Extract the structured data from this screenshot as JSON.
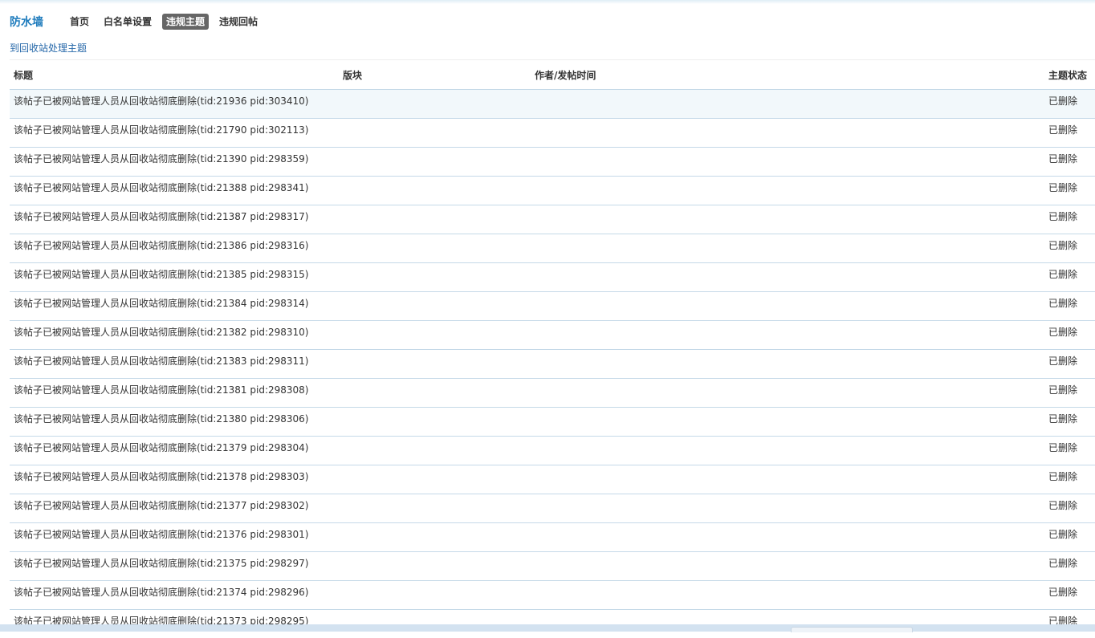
{
  "header": {
    "app_title": "防水墙",
    "tabs": [
      {
        "label": "首页",
        "active": false
      },
      {
        "label": "白名单设置",
        "active": false
      },
      {
        "label": "违规主题",
        "active": true
      },
      {
        "label": "违规回帖",
        "active": false
      }
    ]
  },
  "recycle_link": "到回收站处理主题",
  "table": {
    "headers": {
      "title": "标题",
      "board": "版块",
      "author": "作者/发帖时间",
      "status": "主题状态"
    },
    "rows": [
      {
        "title": "该帖子已被网站管理人员从回收站彻底删除(tid:21936 pid:303410)",
        "status": "已删除"
      },
      {
        "title": "该帖子已被网站管理人员从回收站彻底删除(tid:21790 pid:302113)",
        "status": "已删除"
      },
      {
        "title": "该帖子已被网站管理人员从回收站彻底删除(tid:21390 pid:298359)",
        "status": "已删除"
      },
      {
        "title": "该帖子已被网站管理人员从回收站彻底删除(tid:21388 pid:298341)",
        "status": "已删除"
      },
      {
        "title": "该帖子已被网站管理人员从回收站彻底删除(tid:21387 pid:298317)",
        "status": "已删除"
      },
      {
        "title": "该帖子已被网站管理人员从回收站彻底删除(tid:21386 pid:298316)",
        "status": "已删除"
      },
      {
        "title": "该帖子已被网站管理人员从回收站彻底删除(tid:21385 pid:298315)",
        "status": "已删除"
      },
      {
        "title": "该帖子已被网站管理人员从回收站彻底删除(tid:21384 pid:298314)",
        "status": "已删除"
      },
      {
        "title": "该帖子已被网站管理人员从回收站彻底删除(tid:21382 pid:298310)",
        "status": "已删除"
      },
      {
        "title": "该帖子已被网站管理人员从回收站彻底删除(tid:21383 pid:298311)",
        "status": "已删除"
      },
      {
        "title": "该帖子已被网站管理人员从回收站彻底删除(tid:21381 pid:298308)",
        "status": "已删除"
      },
      {
        "title": "该帖子已被网站管理人员从回收站彻底删除(tid:21380 pid:298306)",
        "status": "已删除"
      },
      {
        "title": "该帖子已被网站管理人员从回收站彻底删除(tid:21379 pid:298304)",
        "status": "已删除"
      },
      {
        "title": "该帖子已被网站管理人员从回收站彻底删除(tid:21378 pid:298303)",
        "status": "已删除"
      },
      {
        "title": "该帖子已被网站管理人员从回收站彻底删除(tid:21377 pid:298302)",
        "status": "已删除"
      },
      {
        "title": "该帖子已被网站管理人员从回收站彻底删除(tid:21376 pid:298301)",
        "status": "已删除"
      },
      {
        "title": "该帖子已被网站管理人员从回收站彻底删除(tid:21375 pid:298297)",
        "status": "已删除"
      },
      {
        "title": "该帖子已被网站管理人员从回收站彻底删除(tid:21374 pid:298296)",
        "status": "已删除"
      },
      {
        "title": "该帖子已被网站管理人员从回收站彻底删除(tid:21373 pid:298295)",
        "status": "已删除"
      }
    ]
  },
  "colors": {
    "accent": "#1f7cbd",
    "link": "#2366a8",
    "active_tab_bg": "#666666",
    "row_border": "#c5d9e8"
  }
}
